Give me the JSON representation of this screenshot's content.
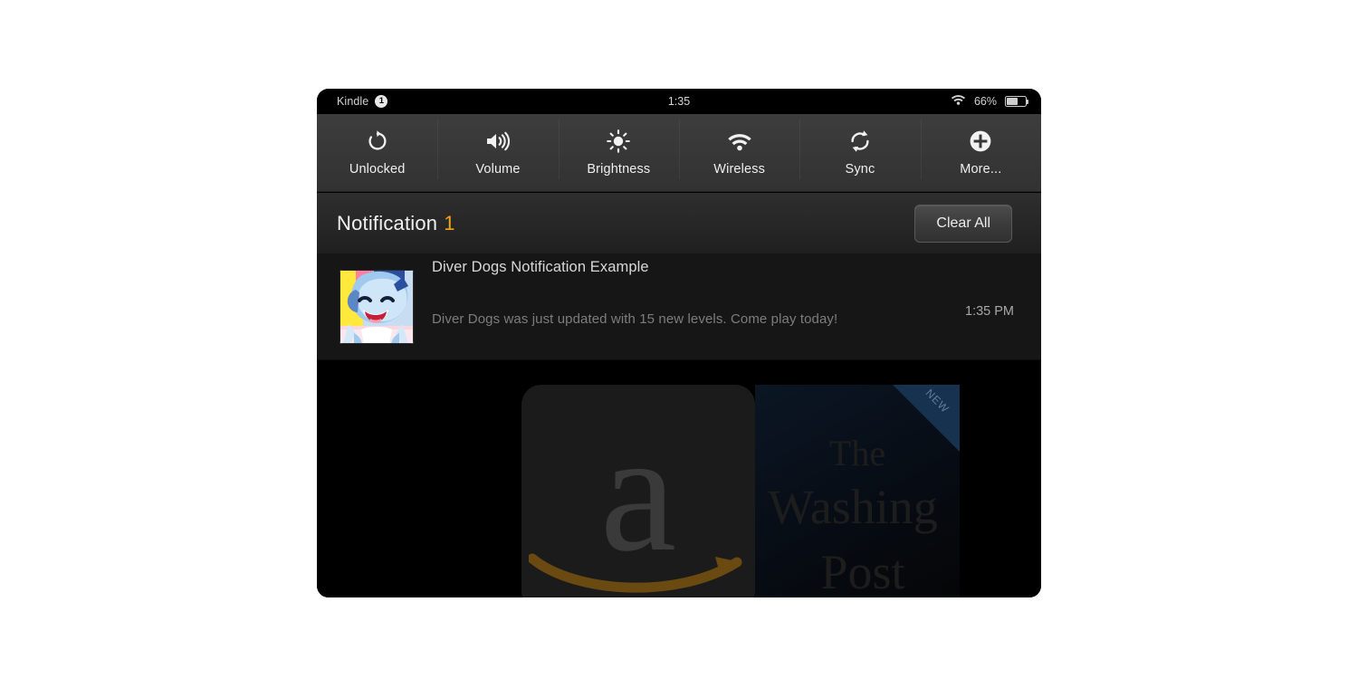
{
  "status_bar": {
    "app_name": "Kindle",
    "badge_count": "1",
    "time": "1:35",
    "battery_percent": "66%",
    "battery_level": 60,
    "wifi_icon": "wifi-icon",
    "battery_icon": "battery-icon"
  },
  "toolbar": {
    "items": [
      {
        "label": "Unlocked",
        "icon": "rotation-unlocked-icon"
      },
      {
        "label": "Volume",
        "icon": "volume-icon"
      },
      {
        "label": "Brightness",
        "icon": "brightness-sun-icon"
      },
      {
        "label": "Wireless",
        "icon": "wifi-icon"
      },
      {
        "label": "Sync",
        "icon": "sync-icon"
      },
      {
        "label": "More...",
        "icon": "plus-circle-icon"
      }
    ]
  },
  "notifications_header": {
    "title": "Notification",
    "count": "1",
    "count_color": "#f0a21b",
    "clear_all_label": "Clear All"
  },
  "notification": {
    "thumbnail_icon": "diver-dogs-app-icon",
    "title": "Diver Dogs Notification Example",
    "body": "Diver Dogs was just updated with 15 new levels. Come play today!",
    "time": "1:35 PM"
  },
  "backdrop": {
    "amazon_tile": {
      "name": "amazon-app-icon",
      "letter": "a"
    },
    "washington_post_tile": {
      "name": "washington-post-app-icon",
      "badge": "NEW",
      "line1": "The",
      "line2": "Washing",
      "line3": "Post"
    }
  },
  "theme": {
    "accent": "#f0a21b",
    "toolbar_bg": "#373737",
    "panel_bg": "#000000"
  }
}
